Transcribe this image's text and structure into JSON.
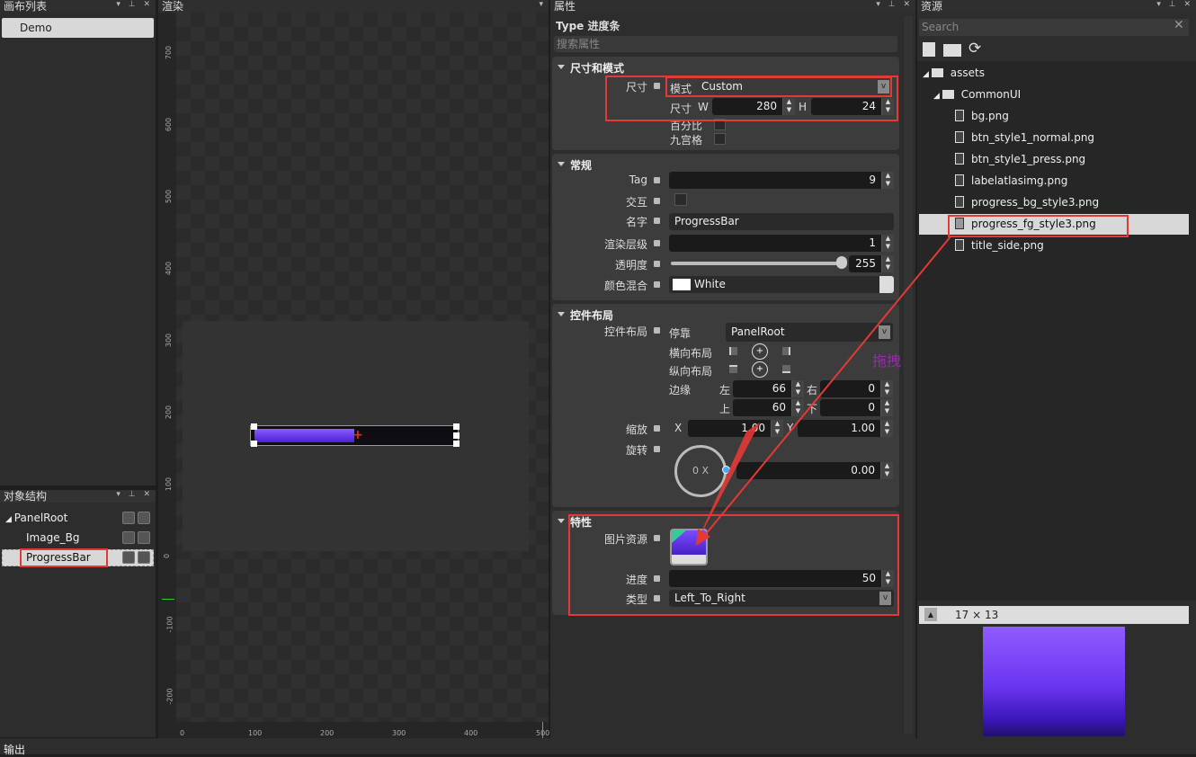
{
  "canvas_list": {
    "title": "画布列表",
    "items": [
      "Demo"
    ]
  },
  "render": {
    "title": "渲染",
    "y_ticks": [
      "700",
      "600",
      "500",
      "400",
      "300",
      "200",
      "100",
      "0",
      "-100",
      "-200"
    ],
    "x_ticks": [
      "0",
      "100",
      "200",
      "300",
      "400",
      "500"
    ],
    "progress_value": 0.5
  },
  "hierarchy": {
    "title": "对象结构",
    "root": "PanelRoot",
    "children": [
      "Image_Bg",
      "ProgressBar"
    ],
    "selected": "ProgressBar"
  },
  "props": {
    "title": "属性",
    "type_label": "Type",
    "type_value": "进度条",
    "search_placeholder": "搜索属性",
    "size_section": {
      "header": "尺寸和模式",
      "size_label": "尺寸",
      "mode_label": "模式",
      "mode_value": "Custom",
      "dim_label": "尺寸",
      "w_label": "W",
      "w_value": "280",
      "h_label": "H",
      "h_value": "24",
      "percent_label": "百分比",
      "nine_label": "九宫格"
    },
    "general": {
      "header": "常规",
      "tag_label": "Tag",
      "tag_value": "9",
      "interact_label": "交互",
      "name_label": "名字",
      "name_value": "ProgressBar",
      "layer_label": "渲染层级",
      "layer_value": "1",
      "opacity_label": "透明度",
      "opacity_value": "255",
      "blend_label": "颜色混合",
      "blend_value": "White"
    },
    "layout": {
      "header": "控件布局",
      "layout_label": "控件布局",
      "dock_label": "停靠",
      "dock_value": "PanelRoot",
      "h_layout_label": "横向布局",
      "v_layout_label": "纵向布局",
      "margin_label": "边缘",
      "left_label": "左",
      "left_value": "66",
      "right_label": "右",
      "right_value": "0",
      "top_label": "上",
      "top_value": "60",
      "bottom_label": "下",
      "bottom_value": "0",
      "scale_label": "缩放",
      "sx_label": "X",
      "sx_value": "1.00",
      "sy_label": "Y",
      "sy_value": "1.00",
      "rotate_label": "旋转",
      "rotate_dial": "0 X",
      "rotate_value": "0.00"
    },
    "special": {
      "header": "特性",
      "image_label": "图片资源",
      "progress_label": "进度",
      "progress_value": "50",
      "type_label": "类型",
      "type_value": "Left_To_Right"
    }
  },
  "drag_annotation": "拖拽",
  "assets": {
    "title": "资源",
    "search_placeholder": "Search",
    "root": "assets",
    "folder": "CommonUI",
    "files": [
      "bg.png",
      "btn_style1_normal.png",
      "btn_style1_press.png",
      "labelatlasimg.png",
      "progress_bg_style3.png",
      "progress_fg_style3.png",
      "title_side.png"
    ],
    "selected": "progress_fg_style3.png",
    "preview_w": "17",
    "preview_x": "×",
    "preview_h": "13"
  },
  "output": {
    "title": "输出"
  },
  "colors": {
    "accent_red": "#e53935",
    "progress_purple": "#6c3cff"
  }
}
